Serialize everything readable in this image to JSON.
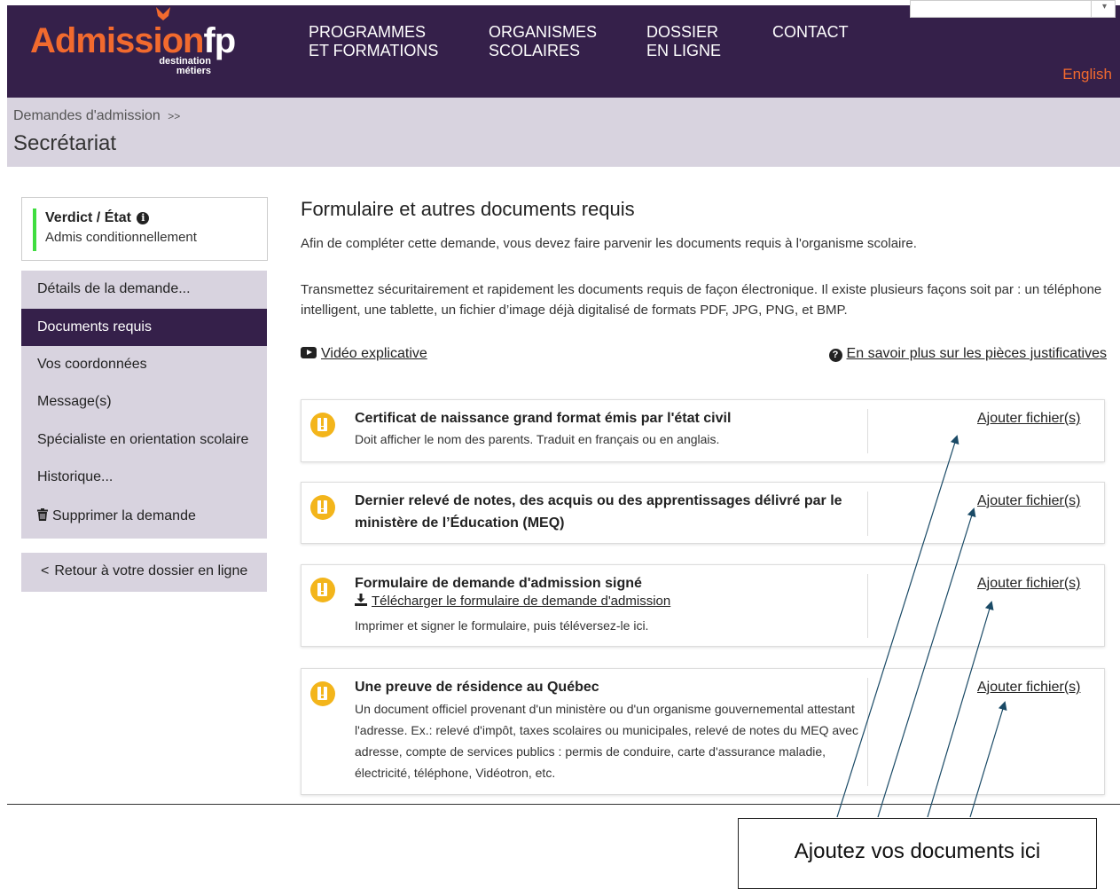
{
  "header": {
    "logo_text": "Admission",
    "logo_suffix": "fp",
    "logo_tagline1": "destination",
    "logo_tagline2": "métiers",
    "nav": [
      {
        "line1": "PROGRAMMES",
        "line2": "ET FORMATIONS"
      },
      {
        "line1": "ORGANISMES",
        "line2": "SCOLAIRES"
      },
      {
        "line1": "DOSSIER",
        "line2": "EN LIGNE"
      },
      {
        "line1": "CONTACT",
        "line2": ""
      }
    ],
    "language_link": "English"
  },
  "breadcrumb": {
    "parent": "Demandes d'admission",
    "separator": ">>",
    "current": "Secrétariat"
  },
  "sidebar": {
    "verdict_title": "Verdict / État",
    "verdict_status": "Admis conditionnellement",
    "verdict_color": "#3fdd3f",
    "items": [
      {
        "label": "Détails de la demande..."
      },
      {
        "label": "Documents requis"
      },
      {
        "label": "Vos coordonnées"
      },
      {
        "label": "Message(s)"
      },
      {
        "label": "Spécialiste en orientation scolaire"
      },
      {
        "label": "Historique..."
      },
      {
        "label": "Supprimer la demande"
      }
    ],
    "active_item": "Documents requis",
    "back_label": "Retour à votre dossier en ligne"
  },
  "main": {
    "title": "Formulaire et autres documents requis",
    "intro": "Afin de compléter cette demande, vous devez faire parvenir les documents requis à l'organisme scolaire.",
    "instructions": "Transmettez sécuritairement et rapidement les documents requis de façon électronique. Il existe plusieurs façons soit par : un téléphone intelligent, une tablette, un fichier d’image déjà digitalisé de formats PDF, JPG, PNG, et BMP.",
    "video_link": "Vidéo explicative",
    "info_link": "En savoir plus sur les pièces justificatives",
    "documents": [
      {
        "title": "Certificat de naissance grand format émis par l'état civil",
        "description": "Doit afficher le nom des parents. Traduit en français ou en anglais.",
        "action": "Ajouter fichier(s)"
      },
      {
        "title": "Dernier relevé de notes, des acquis ou des apprentissages délivré par le ministère de l’Éducation (MEQ)",
        "description": "",
        "action": "Ajouter fichier(s)"
      },
      {
        "title": "Formulaire de demande d'admission signé",
        "download_link": "Télécharger le formulaire de demande d'admission",
        "description": "Imprimer et signer le formulaire, puis téléversez-le ici.",
        "action": "Ajouter fichier(s)"
      },
      {
        "title": "Une preuve de résidence au Québec",
        "description": "Un document officiel provenant d'un ministère ou d'un organisme gouvernemental attestant l'adresse. Ex.: relevé d'impôt, taxes scolaires ou municipales, relevé de notes du MEQ avec adresse, compte de services publics : permis de conduire, carte d'assurance maladie, électricité, téléphone, Vidéotron, etc.",
        "action": "Ajouter fichier(s)"
      }
    ]
  },
  "annotation": {
    "callout": "Ajoutez vos documents ici"
  },
  "colors": {
    "brand_purple": "#35204a",
    "brand_orange": "#f26a2e",
    "panel_lilac": "#d8d3df",
    "warning_yellow": "#f3b51b"
  }
}
